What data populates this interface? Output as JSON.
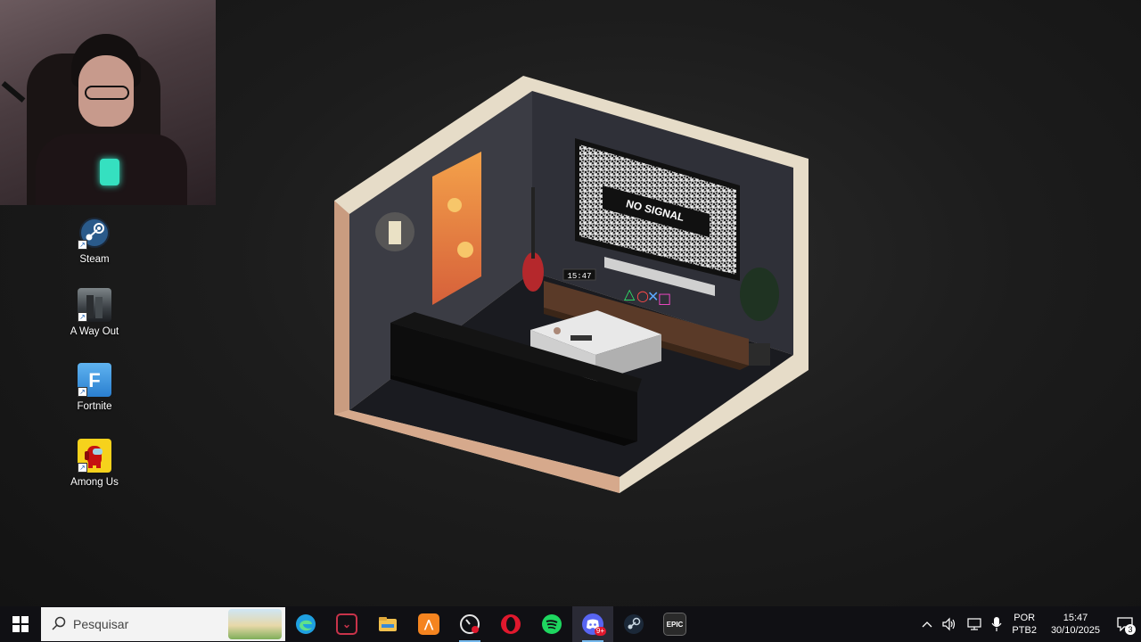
{
  "desktop": {
    "icons": [
      {
        "label": "Steam",
        "icon": "steam-icon"
      },
      {
        "label": "A Way Out",
        "icon": "a-way-out-icon"
      },
      {
        "label": "Fortnite",
        "icon": "fortnite-icon"
      },
      {
        "label": "Among Us",
        "icon": "among-us-icon"
      }
    ]
  },
  "wallpaper": {
    "tv_text": "NO SIGNAL",
    "clock_text": "15:47"
  },
  "taskbar": {
    "search_placeholder": "Pesquisar",
    "apps": [
      {
        "name": "edge-icon",
        "color": "#1fa0e0"
      },
      {
        "name": "media-app-icon",
        "color": "#c8334a"
      },
      {
        "name": "file-explorer-icon",
        "color": "#f2c14e"
      },
      {
        "name": "fl-studio-icon",
        "color": "#f5841f"
      },
      {
        "name": "screen-recorder-icon",
        "color": "#e6e6e6"
      },
      {
        "name": "opera-icon",
        "color": "#e0182d"
      },
      {
        "name": "spotify-icon",
        "color": "#1ed760"
      },
      {
        "name": "discord-icon",
        "color": "#5865f2"
      },
      {
        "name": "steam-icon",
        "color": "#c7d5e0"
      },
      {
        "name": "epic-games-icon",
        "color": "#2a2a2a"
      }
    ],
    "discord_badge": "9+",
    "tray": {
      "lang_line1": "POR",
      "lang_line2": "PTB2",
      "time": "15:47",
      "date": "30/10/2025",
      "notification_count": "3"
    }
  }
}
